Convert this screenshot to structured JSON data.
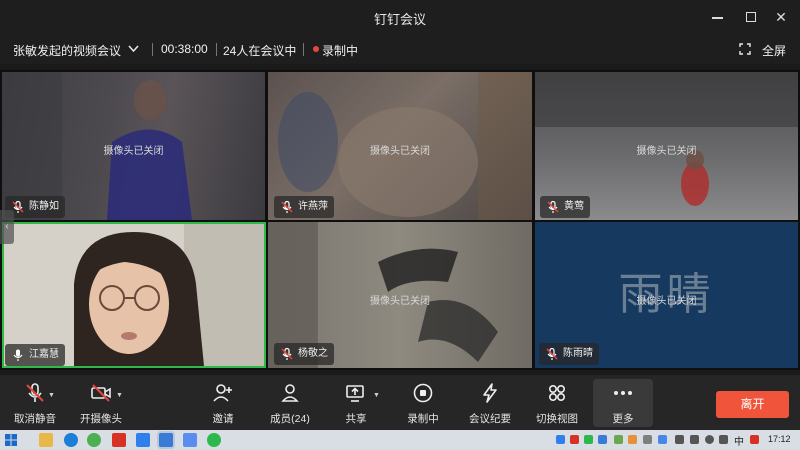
{
  "window": {
    "title": "钉钉会议"
  },
  "meeting": {
    "name": "张敏发起的视频会议",
    "duration": "00:38:00",
    "participants_in_meeting": "24人在会议中",
    "recording_status": "录制中",
    "fullscreen_label": "全屏"
  },
  "camera_off_text": "摄像头已关闭",
  "tiles": [
    {
      "name": "陈静如",
      "camera_off": true,
      "muted": true
    },
    {
      "name": "许燕萍",
      "camera_off": true,
      "muted": true
    },
    {
      "name": "黄莺",
      "camera_off": true,
      "muted": true
    },
    {
      "name": "江嘉慧",
      "camera_off": false,
      "muted": false,
      "active_speaker": true
    },
    {
      "name": "杨敬之",
      "camera_off": true,
      "muted": true
    },
    {
      "name": "陈雨晴",
      "camera_off": true,
      "muted": true,
      "avatar_text": "雨晴"
    }
  ],
  "toolbar": {
    "unmute": "取消静音",
    "start_camera": "开摄像头",
    "invite": "邀请",
    "members": "成员(24)",
    "share": "共享",
    "recording": "录制中",
    "minutes": "会议纪要",
    "switch_view": "切换视图",
    "more": "更多",
    "leave": "离开"
  },
  "taskbar": {
    "input_method": "中",
    "clock": "17:12"
  },
  "colors": {
    "accent_green": "#2fb94a",
    "leave_orange": "#f0553c",
    "record_red": "#e8453c",
    "mute_red": "#e8453c"
  }
}
